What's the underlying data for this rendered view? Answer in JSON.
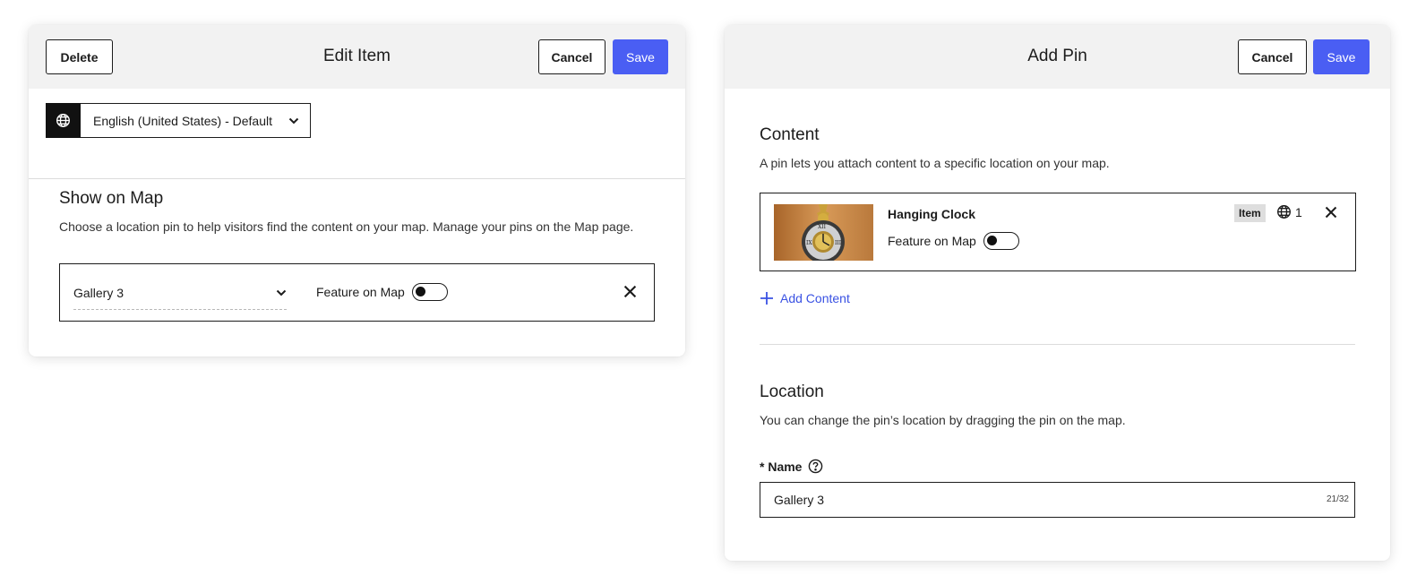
{
  "edit_item": {
    "header": {
      "title": "Edit Item",
      "delete_label": "Delete",
      "cancel_label": "Cancel",
      "save_label": "Save"
    },
    "language": {
      "selected": "English (United States) - Default"
    },
    "show_on_map": {
      "title": "Show on Map",
      "description": "Choose a location pin to help visitors find the content on your map. Manage your pins on the Map page.",
      "pin_selected": "Gallery 3",
      "feature_label": "Feature on Map",
      "feature_on": false
    }
  },
  "add_pin": {
    "header": {
      "title": "Add Pin",
      "cancel_label": "Cancel",
      "save_label": "Save"
    },
    "content": {
      "title": "Content",
      "description": "A pin lets you attach content to a specific location on your map.",
      "item": {
        "title": "Hanging Clock",
        "badge": "Item",
        "language_count": "1",
        "feature_label": "Feature on Map",
        "feature_on": false
      },
      "add_content_label": "Add Content"
    },
    "location": {
      "title": "Location",
      "description": "You can change the pin’s location by dragging the pin on the map.",
      "name_label": "* Name",
      "name_value": "Gallery 3",
      "char_count": "21/32"
    }
  },
  "colors": {
    "primary": "#4a5ef3",
    "link": "#3a52e3",
    "header_bg": "#f2f2f2"
  }
}
